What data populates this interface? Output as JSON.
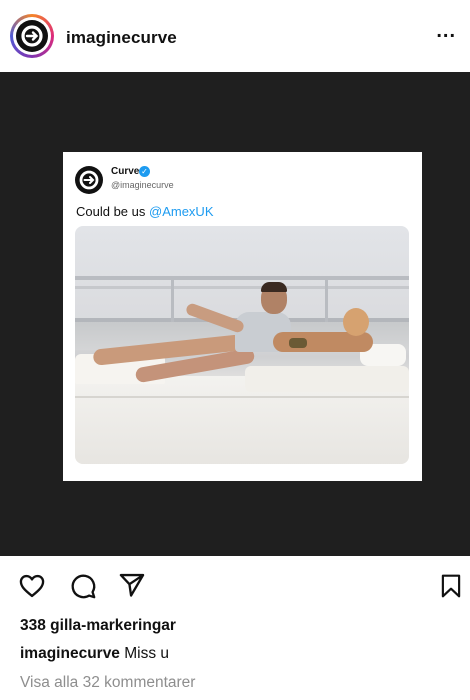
{
  "header": {
    "username": "imaginecurve",
    "more_label": "..."
  },
  "tweet": {
    "name": "Curve",
    "handle": "@imaginecurve",
    "text": "Could be us ",
    "mention": "@AmexUK",
    "verified_mark": "✓"
  },
  "post": {
    "likes": "338 gilla-markeringar",
    "caption_user": "imaginecurve",
    "caption_text": " Miss u",
    "comments_link": "Visa alla 32 kommentarer"
  },
  "icons": {
    "like": "heart-icon",
    "comment": "comment-icon",
    "share": "send-icon",
    "save": "bookmark-icon",
    "more": "more-icon"
  },
  "colors": {
    "accent_blue": "#1d9bf0",
    "post_background": "#1f1f1f",
    "muted_text": "#8e8e8e"
  }
}
